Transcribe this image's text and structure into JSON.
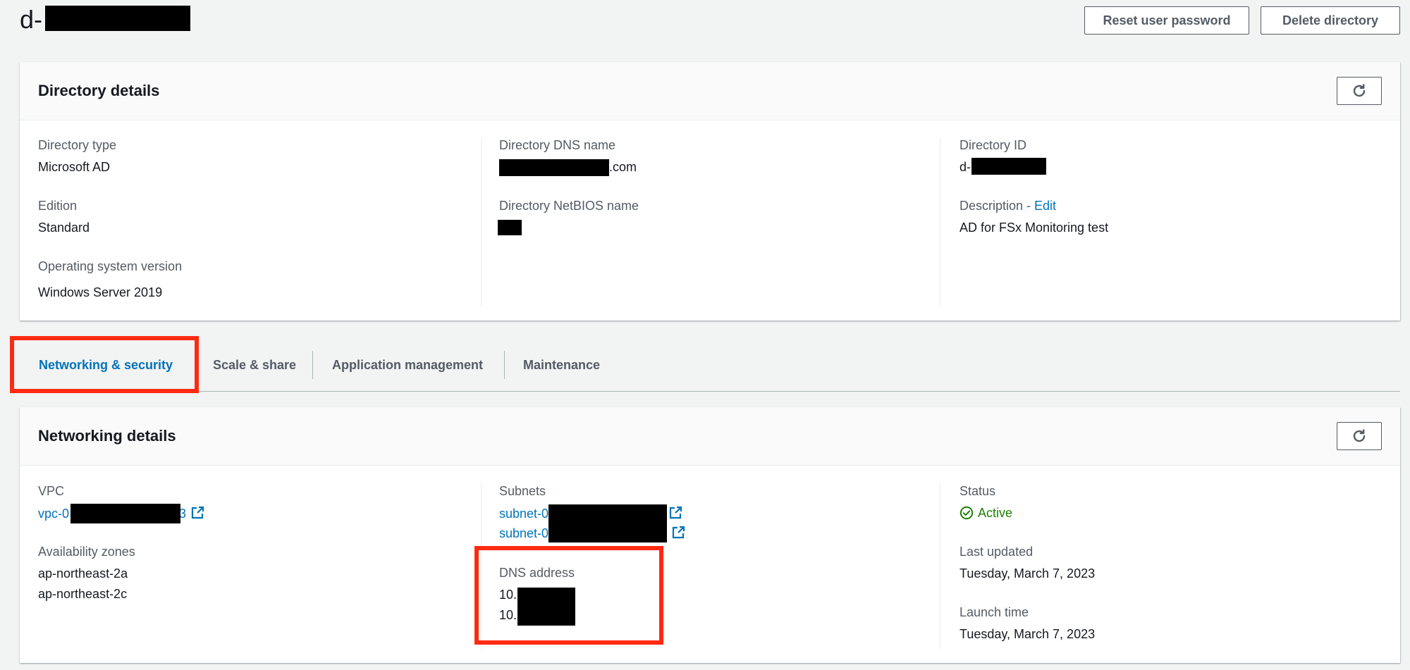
{
  "header": {
    "title": "d-",
    "reset_password_label": "Reset user password",
    "delete_directory_label": "Delete directory"
  },
  "directory_details": {
    "title": "Directory details",
    "refresh_icon": "refresh-icon",
    "directory_type_label": "Directory type",
    "directory_type_value": "Microsoft AD",
    "edition_label": "Edition",
    "edition_value": "Standard",
    "os_version_label": "Operating system version",
    "os_version_value": "Windows Server 2019",
    "dns_name_label": "Directory DNS name",
    "dns_name_suffix": ".com",
    "netbios_label": "Directory NetBIOS name",
    "directory_id_label": "Directory ID",
    "directory_id_prefix": "d-",
    "description_label": "Description - ",
    "description_edit": "Edit",
    "description_value": "AD for FSx Monitoring test"
  },
  "tabs": [
    {
      "label": "Networking & security",
      "active": true
    },
    {
      "label": "Scale & share",
      "active": false
    },
    {
      "label": "Application management",
      "active": false
    },
    {
      "label": "Maintenance",
      "active": false
    }
  ],
  "networking_details": {
    "title": "Networking details",
    "vpc_label": "VPC",
    "vpc_prefix": "vpc-0",
    "vpc_trailing": "3",
    "availability_zones_label": "Availability zones",
    "availability_zones": [
      "ap-northeast-2a",
      "ap-northeast-2c"
    ],
    "subnets_label": "Subnets",
    "subnets": [
      "subnet-0",
      "subnet-0"
    ],
    "dns_address_label": "DNS address",
    "dns_addresses": [
      "10.",
      "10."
    ],
    "status_label": "Status",
    "status_value": "Active",
    "last_updated_label": "Last updated",
    "last_updated_value": "Tuesday, March 7, 2023",
    "launch_time_label": "Launch time",
    "launch_time_value": "Tuesday, March 7, 2023"
  },
  "colors": {
    "link": "#0073bb",
    "success": "#1d8102",
    "highlight": "#ff2a12",
    "redaction": "#000000"
  }
}
